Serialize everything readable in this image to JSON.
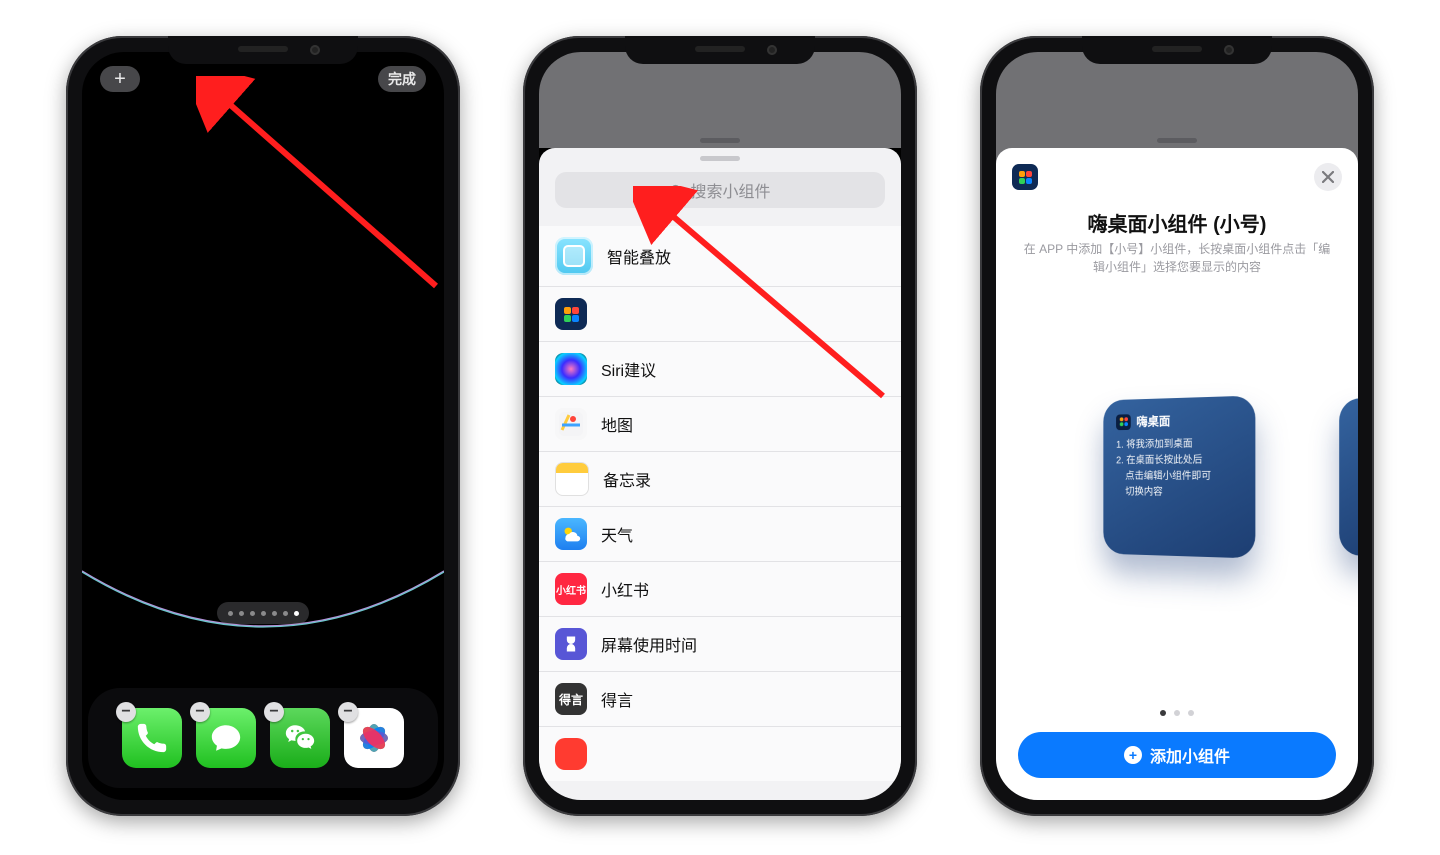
{
  "jiggle": {
    "add_glyph": "+",
    "done_label": "完成",
    "page_count": 7,
    "active_page_index": 6,
    "dock": [
      {
        "name": "phone-icon"
      },
      {
        "name": "messages-icon"
      },
      {
        "name": "wechat-icon"
      },
      {
        "name": "photos-icon"
      }
    ]
  },
  "sheet": {
    "search_placeholder": "搜索小组件",
    "items": [
      {
        "label": "智能叠放",
        "icon": "stack"
      },
      {
        "label": "",
        "icon": "hai"
      },
      {
        "label": "Siri建议",
        "icon": "siri"
      },
      {
        "label": "地图",
        "icon": "map"
      },
      {
        "label": "备忘录",
        "icon": "notes"
      },
      {
        "label": "天气",
        "icon": "weather"
      },
      {
        "label": "小红书",
        "icon": "xhs",
        "badge": "小红书"
      },
      {
        "label": "屏幕使用时间",
        "icon": "scrtime"
      },
      {
        "label": "得言",
        "icon": "deyan",
        "badge": "得言"
      }
    ]
  },
  "detail": {
    "title": "嗨桌面小组件 (小号)",
    "subtitle": "在 APP 中添加【小号】小组件，长按桌面小组件点击「编辑小组件」选择您要显示的内容",
    "preview": {
      "header": "嗨桌面",
      "line1": "1. 将我添加到桌面",
      "line2a": "2. 在桌面长按此处后",
      "line2b": "点击编辑小组件即可",
      "line2c": "切换内容"
    },
    "page_count": 3,
    "active_page_index": 0,
    "add_label": "添加小组件"
  }
}
